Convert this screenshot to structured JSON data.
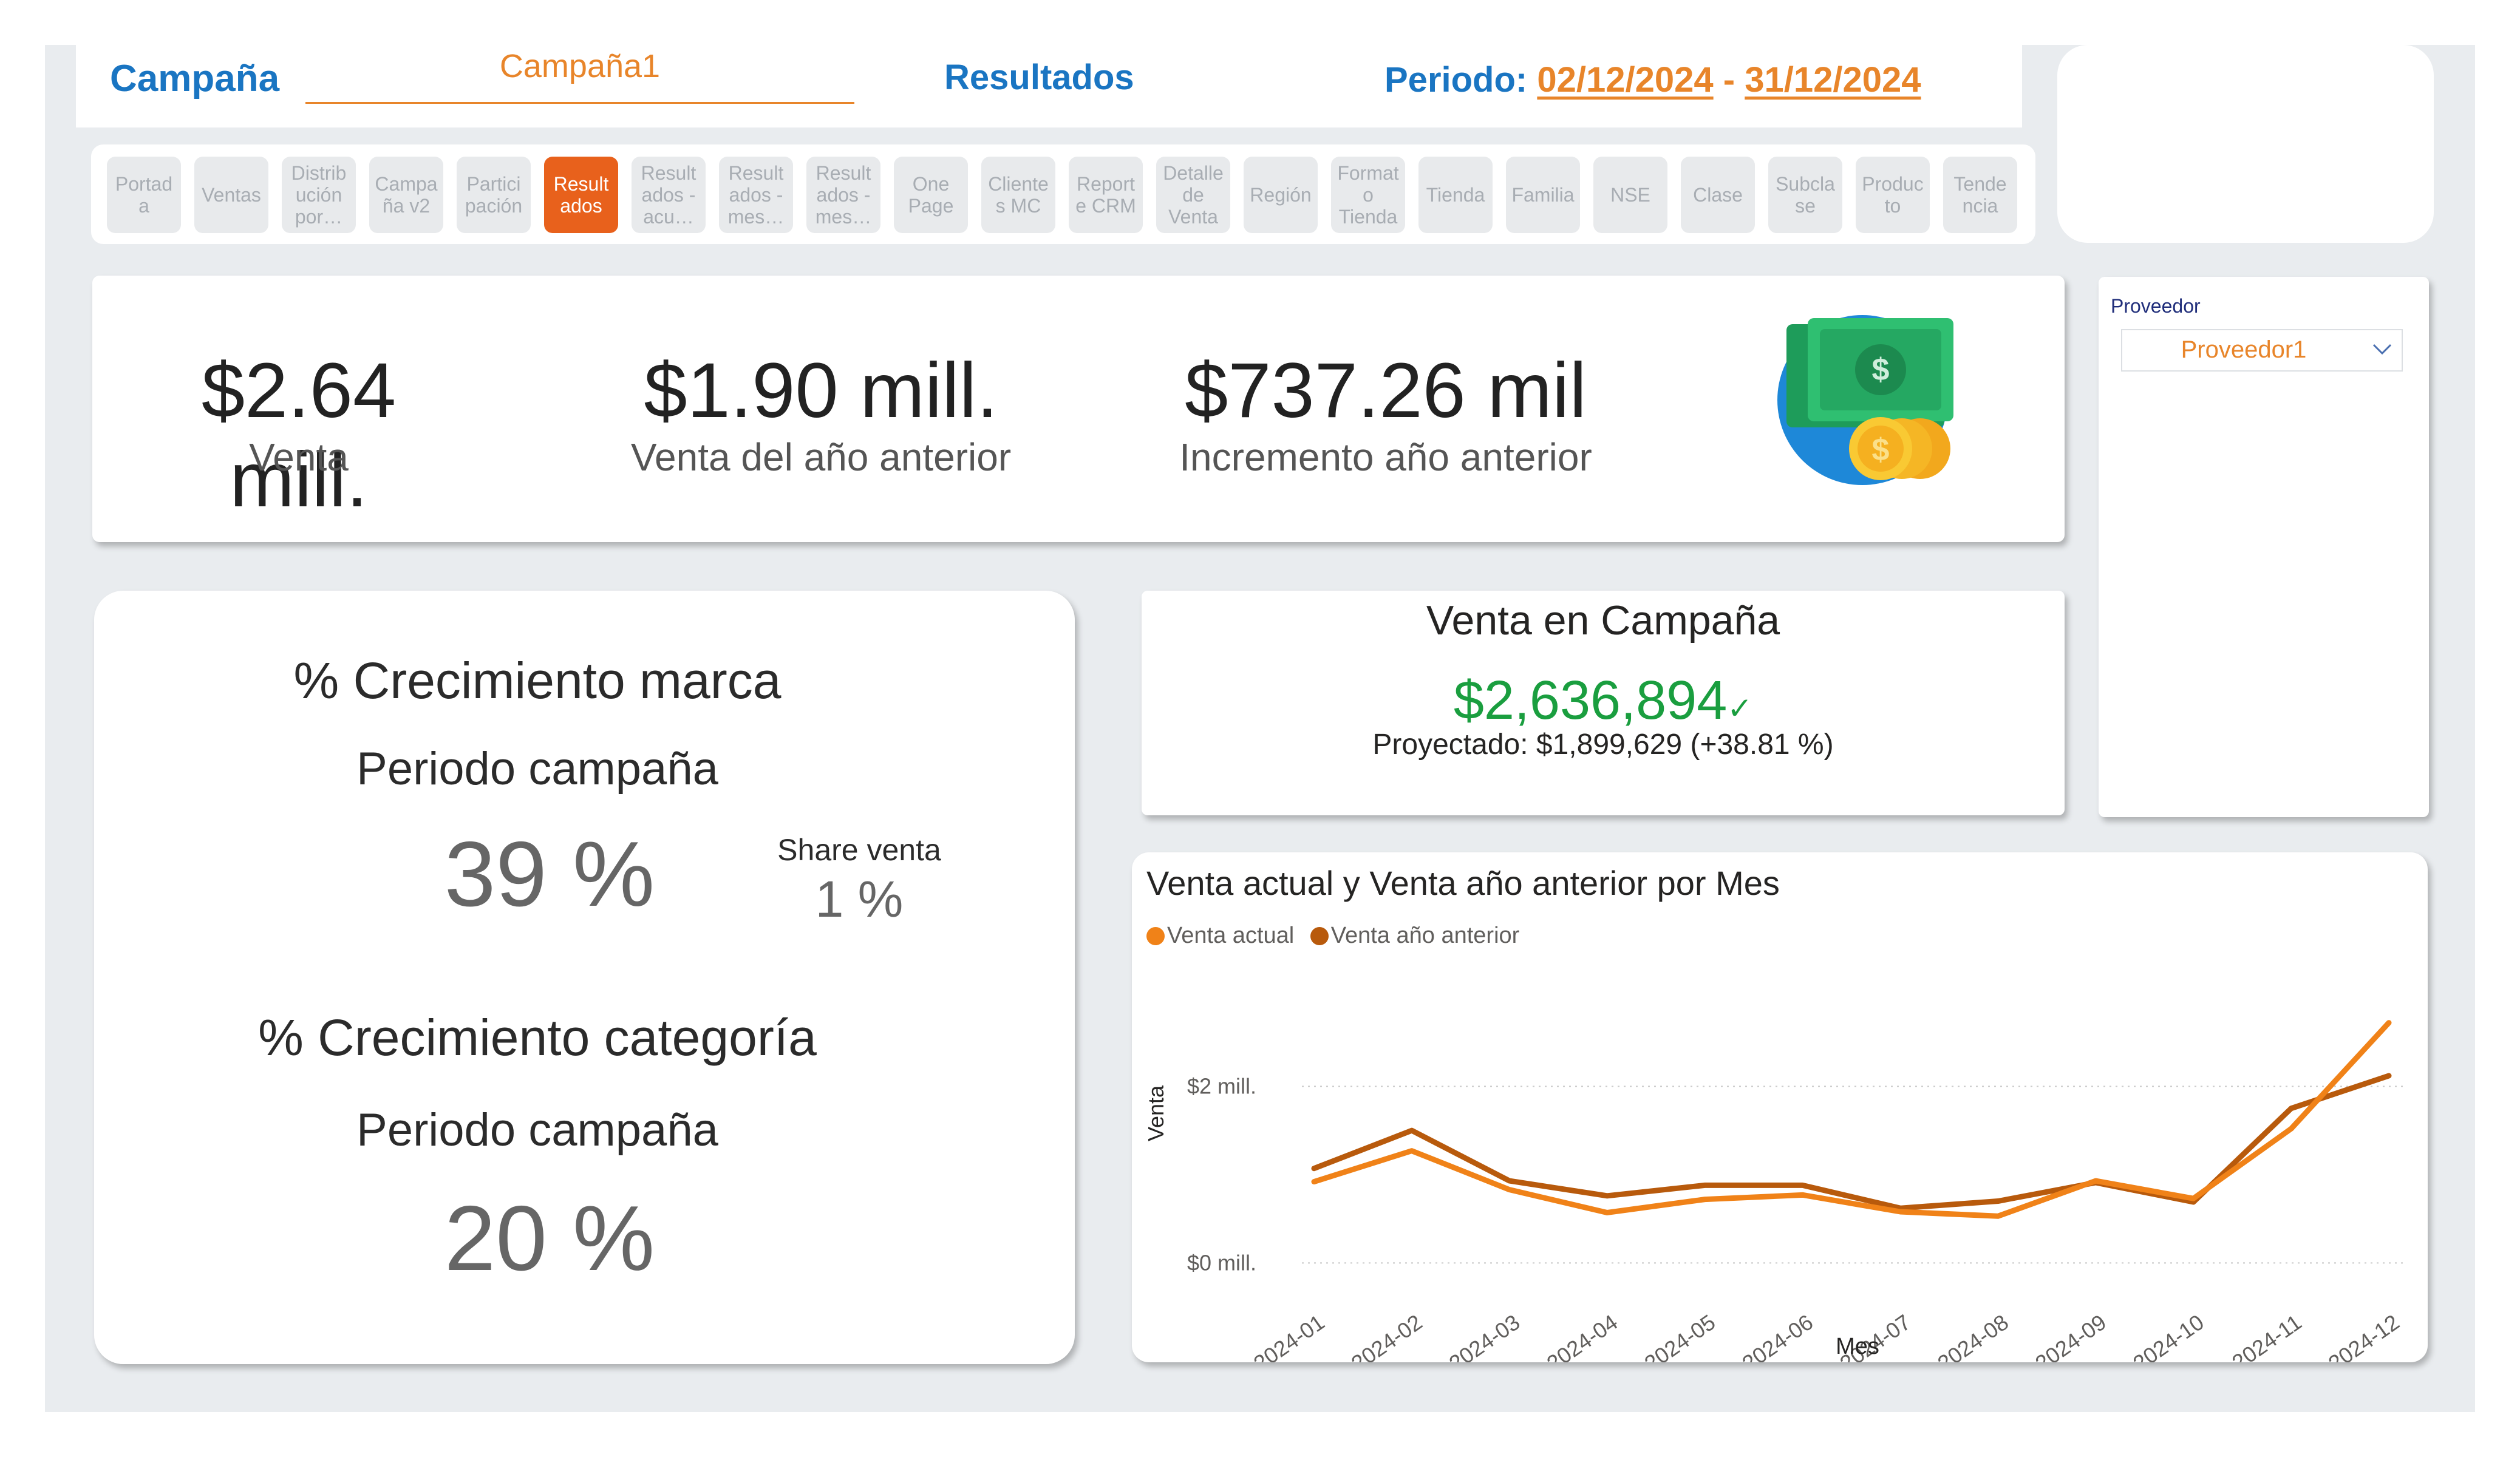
{
  "header": {
    "campaign_label": "Campaña",
    "campaign_value": "Campaña1",
    "results_label": "Resultados",
    "period_label": "Periodo:",
    "period_start": "02/12/2024",
    "period_sep": "-",
    "period_end": "31/12/2024"
  },
  "nav": [
    {
      "label": "Portad\na",
      "active": false
    },
    {
      "label": "Ventas",
      "active": false
    },
    {
      "label": "Distrib\nución\npor…",
      "active": false
    },
    {
      "label": "Campa\nña v2",
      "active": false
    },
    {
      "label": "Partici\npación",
      "active": false
    },
    {
      "label": "Result\nados",
      "active": true
    },
    {
      "label": "Result\nados -\nacu…",
      "active": false
    },
    {
      "label": "Result\nados -\nmes…",
      "active": false
    },
    {
      "label": "Result\nados -\nmes…",
      "active": false
    },
    {
      "label": "One\nPage",
      "active": false
    },
    {
      "label": "Cliente\ns MC",
      "active": false
    },
    {
      "label": "Report\ne CRM",
      "active": false
    },
    {
      "label": "Detalle\nde\nVenta",
      "active": false
    },
    {
      "label": "Región",
      "active": false
    },
    {
      "label": "Format\no\nTienda",
      "active": false
    },
    {
      "label": "Tienda",
      "active": false
    },
    {
      "label": "Familia",
      "active": false
    },
    {
      "label": "NSE",
      "active": false
    },
    {
      "label": "Clase",
      "active": false
    },
    {
      "label": "Subcla\nse",
      "active": false
    },
    {
      "label": "Produc\nto",
      "active": false
    },
    {
      "label": "Tende\nncia",
      "active": false
    }
  ],
  "kpis": [
    {
      "value": "$2.64 mill.",
      "label": "Venta"
    },
    {
      "value": "$1.90 mill.",
      "label": "Venta del año anterior"
    },
    {
      "value": "$737.26 mil",
      "label": "Incremento año anterior"
    }
  ],
  "kpi_icon": "money-coins-icon",
  "growth": {
    "brand_title": "% Crecimiento marca",
    "brand_period": "Periodo campaña",
    "brand_value": "39 %",
    "share_label": "Share venta",
    "share_value": "1 %",
    "category_title": "% Crecimiento categoría",
    "category_period": "Periodo campaña",
    "category_value": "20 %"
  },
  "campaign_sales": {
    "title": "Venta en Campaña",
    "value": "$2,636,894",
    "check": "✓",
    "projected": "Proyectado: $1,899,629 (+38.81 %)",
    "value_color": "#1a9e3f"
  },
  "provider": {
    "label": "Proveedor",
    "value": "Proveedor1"
  },
  "colors": {
    "accent_blue": "#1a75c2",
    "accent_orange": "#e8852a",
    "active_tab": "#e8611c"
  },
  "chart_data": {
    "type": "line",
    "title": "Venta actual y Venta año anterior por Mes",
    "xlabel": "Mes",
    "ylabel": "Venta",
    "categories": [
      "2024-01",
      "2024-02",
      "2024-03",
      "2024-04",
      "2024-05",
      "2024-06",
      "2024-07",
      "2024-08",
      "2024-09",
      "2024-10",
      "2024-11",
      "2024-12"
    ],
    "series": [
      {
        "name": "Venta actual",
        "color": "#f08218",
        "values": [
          0.92,
          1.27,
          0.83,
          0.57,
          0.72,
          0.77,
          0.58,
          0.53,
          0.93,
          0.73,
          1.52,
          2.72
        ]
      },
      {
        "name": "Venta año anterior",
        "color": "#b85a0c",
        "values": [
          1.07,
          1.5,
          0.93,
          0.76,
          0.88,
          0.88,
          0.62,
          0.7,
          0.91,
          0.69,
          1.75,
          2.12
        ]
      }
    ],
    "ytick_labels": [
      "$0 mill.",
      "$2 mill."
    ],
    "yticks": [
      0,
      2
    ],
    "ylim": [
      -0.3,
      3.0
    ],
    "grid": true,
    "legend": "top-left"
  }
}
